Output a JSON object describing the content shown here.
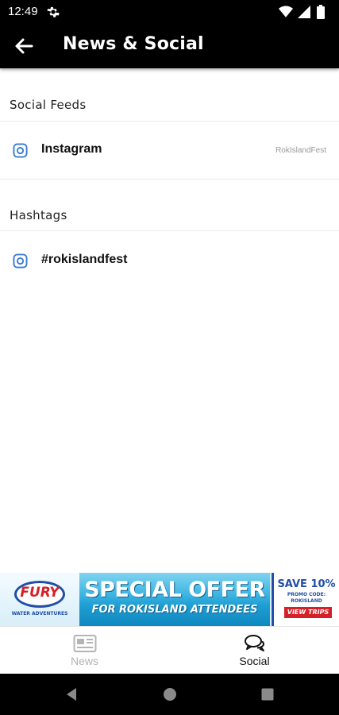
{
  "status_bar": {
    "time": "12:49",
    "icons": [
      "gear-icon",
      "wifi-icon",
      "signal-icon",
      "battery-icon"
    ]
  },
  "app_bar": {
    "title": "News & Social",
    "back_icon": "arrow-left-icon",
    "background": "#000000",
    "text_color": "#ffffff"
  },
  "sections": {
    "social_feeds": {
      "header": "Social Feeds",
      "items": [
        {
          "label": "Instagram",
          "handle": "RokIslandFest",
          "icon": "instagram-icon"
        }
      ]
    },
    "hashtags": {
      "header": "Hashtags",
      "items": [
        {
          "label": "#rokislandfest",
          "icon": "instagram-icon"
        }
      ]
    }
  },
  "ad_banner": {
    "brand": "FURY",
    "brand_tagline": "WATER ADVENTURES",
    "headline": "SPECIAL OFFER",
    "subline": "FOR ROKISLAND ATTENDEES",
    "offer": "SAVE 10%",
    "promo_label": "PROMO CODE:",
    "promo_code": "ROKISLAND",
    "cta": "VIEW TRIPS",
    "accent": "#d52028",
    "brand_color": "#1f4fa8"
  },
  "bottom_nav": {
    "tabs": [
      {
        "label": "News",
        "icon": "newspaper-icon",
        "active": false
      },
      {
        "label": "Social",
        "icon": "chat-bubbles-icon",
        "active": true
      }
    ],
    "inactive_color": "#b4b4b4",
    "active_color": "#111111"
  },
  "system_nav": {
    "buttons": [
      "back-triangle-icon",
      "home-circle-icon",
      "recents-square-icon"
    ]
  },
  "colors": {
    "icon_accent": "#3a7bd5",
    "divider": "#ececec"
  }
}
